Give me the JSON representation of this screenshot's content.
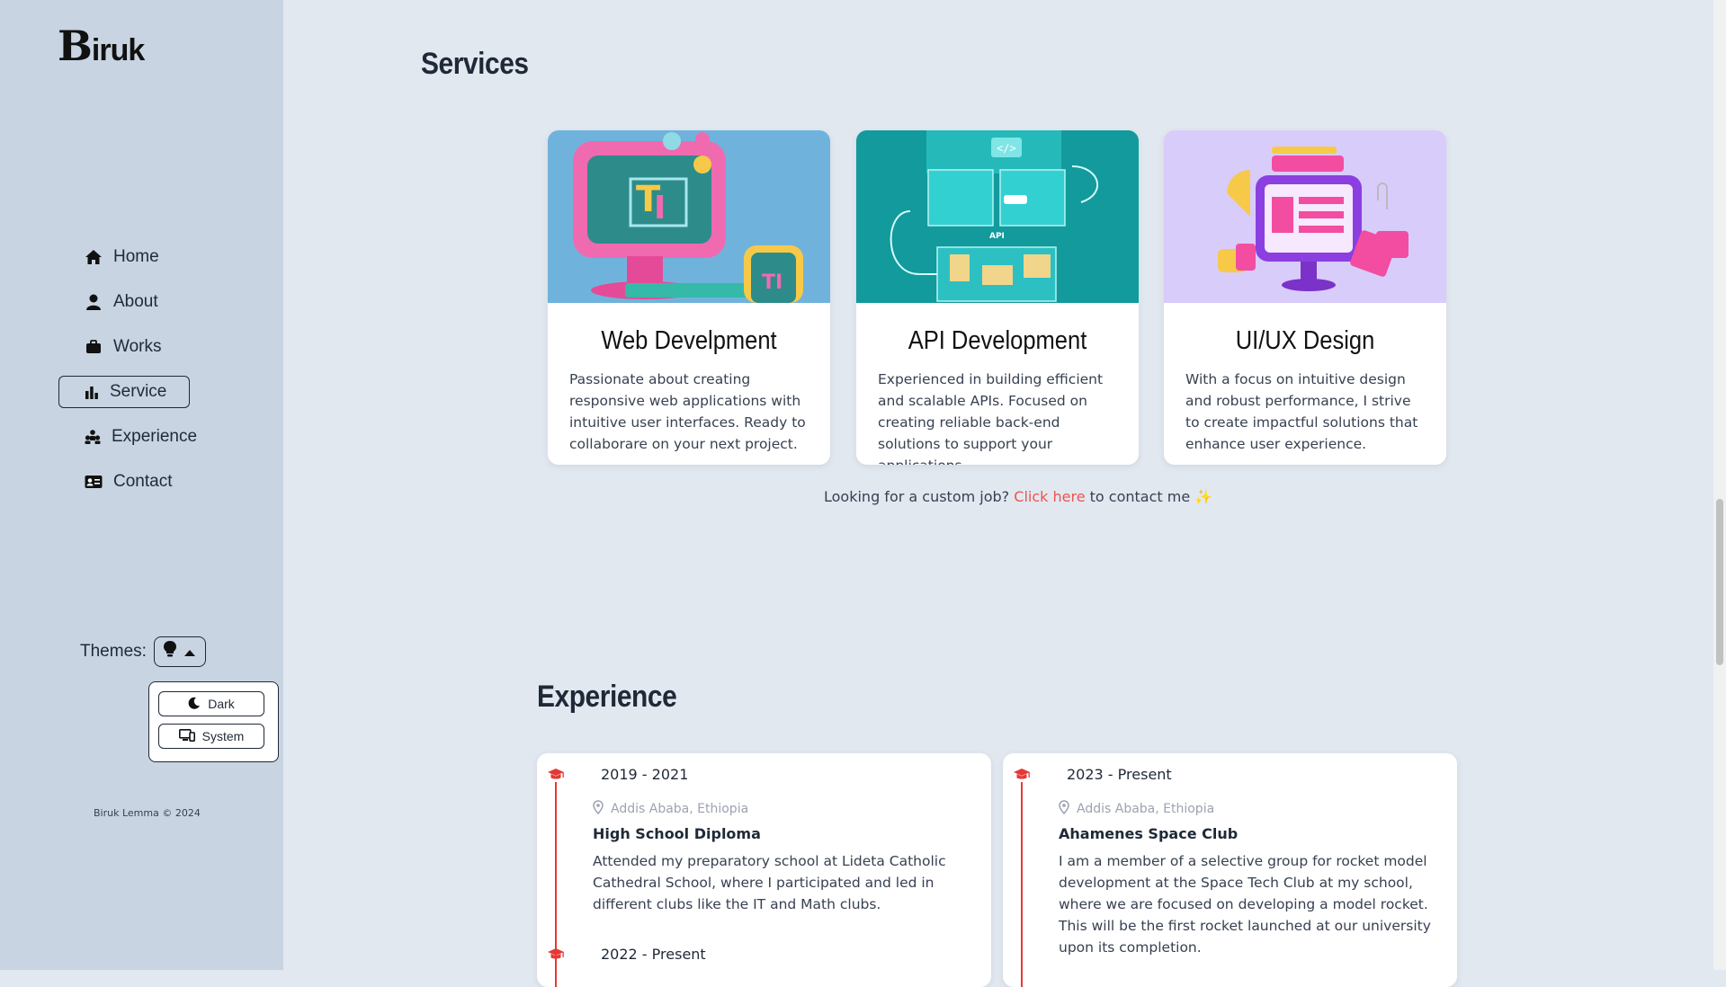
{
  "sidebar": {
    "logo": "Biruk",
    "nav": [
      {
        "label": "Home",
        "icon": "home-icon"
      },
      {
        "label": "About",
        "icon": "user-icon"
      },
      {
        "label": "Works",
        "icon": "briefcase-icon"
      },
      {
        "label": "Service",
        "icon": "bar-chart-icon",
        "active": true
      },
      {
        "label": "Experience",
        "icon": "sitemap-icon"
      },
      {
        "label": "Contact",
        "icon": "id-card-icon"
      }
    ],
    "themes_label": "Themes:",
    "theme_options": [
      {
        "label": "Dark",
        "icon": "moon-icon"
      },
      {
        "label": "System",
        "icon": "monitor-icon"
      }
    ],
    "copyright": "Biruk Lemma © 2024"
  },
  "services": {
    "title": "Services",
    "cards": [
      {
        "title": "Web Develpment",
        "desc": "Passionate about creating responsive web applications with intuitive user interfaces. Ready to collaborare on your next project.",
        "bg": "#6fb3dc"
      },
      {
        "title": "API Development",
        "desc": "Experienced in building efficient and scalable APIs. Focused on creating reliable back-end solutions to support your applications.",
        "bg": "#14a5a6"
      },
      {
        "title": "UI/UX Design",
        "desc": "With a focus on intuitive design and robust performance, I strive to create impactful solutions that enhance user experience.",
        "bg": "#d8ccfb"
      }
    ],
    "api_label": "API",
    "custom_prefix": "Looking for a custom job?",
    "custom_link": "Click here",
    "custom_suffix": "to contact me ✨"
  },
  "experience": {
    "title": "Experience",
    "items": [
      {
        "date": "2019 - 2021",
        "location": "Addis Ababa, Ethiopia",
        "title": "High School Diploma",
        "desc": "Attended my preparatory school at Lideta Catholic Cathedral School, where I participated and led in different clubs like the IT and Math clubs.",
        "next_date": "2022 - Present"
      },
      {
        "date": "2023 - Present",
        "location": "Addis Ababa, Ethiopia",
        "title": "Ahamenes Space Club",
        "desc": "I am a member of a selective group for rocket model development at the Space Tech Club at my school, where we are focused on developing a model rocket. This will be the first rocket launched at our university upon its completion."
      }
    ]
  },
  "colors": {
    "accent": "#e53935",
    "sidebar": "#c8d4e2",
    "page": "#e2e8f0"
  }
}
